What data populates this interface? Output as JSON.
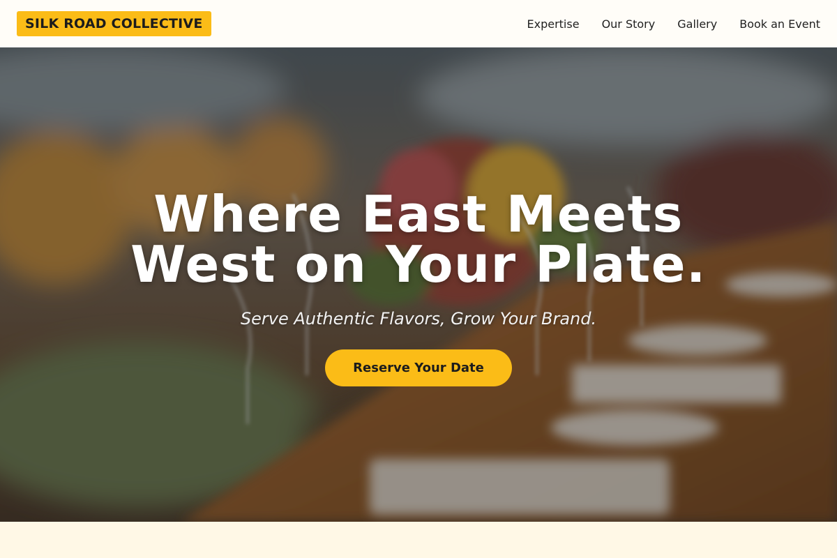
{
  "header": {
    "logo_text": "SILK ROAD COLLECTIVE",
    "nav": [
      {
        "label": "Expertise"
      },
      {
        "label": "Our Story"
      },
      {
        "label": "Gallery"
      },
      {
        "label": "Book an Event"
      }
    ]
  },
  "hero": {
    "background_image": "blurred banquet table with wine glasses, plates and floral centerpiece",
    "title_line1": "Where East Meets",
    "title_line2": "West on Your Plate.",
    "subtitle": "Serve Authentic Flavors, Grow Your Brand.",
    "cta_label": "Reserve Your Date"
  },
  "colors": {
    "accent": "#fbbc17",
    "header_bg": "#fffdf8",
    "page_bg": "#fff8e6",
    "text_dark": "#1c1c1c"
  }
}
